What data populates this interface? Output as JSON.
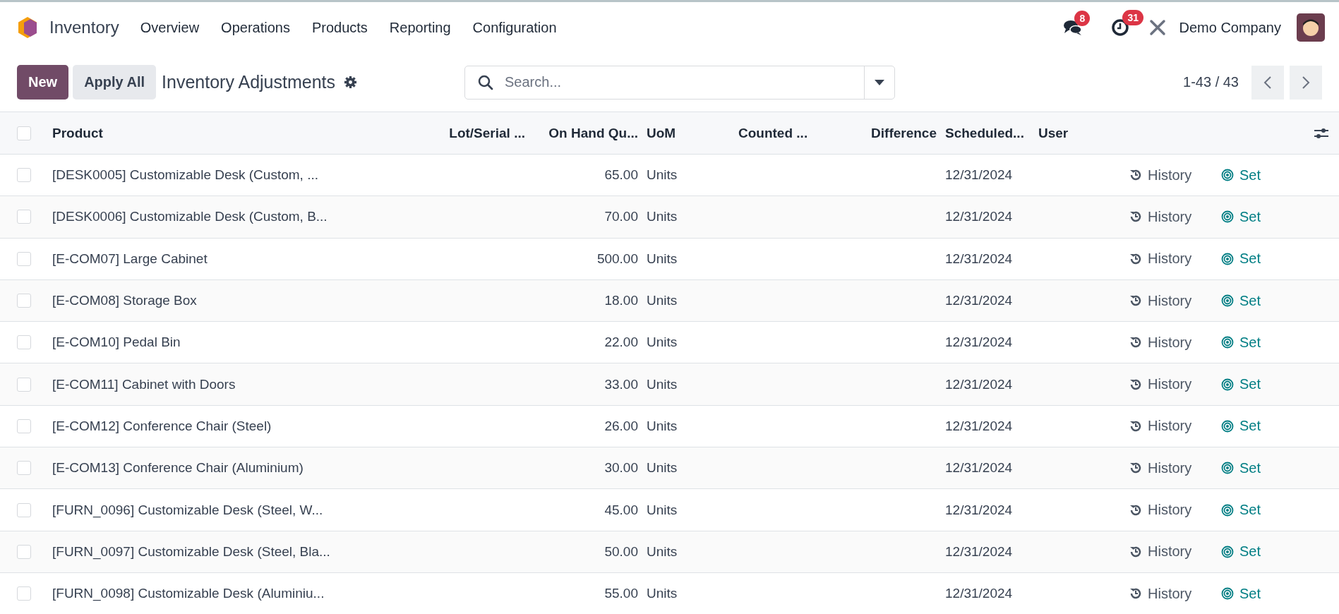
{
  "navbar": {
    "app_name": "Inventory",
    "menu": [
      "Overview",
      "Operations",
      "Products",
      "Reporting",
      "Configuration"
    ],
    "messages_badge": "8",
    "activities_badge": "31",
    "company": "Demo Company"
  },
  "control_panel": {
    "new_button": "New",
    "apply_all_button": "Apply All",
    "title": "Inventory Adjustments",
    "search": {
      "placeholder": "Search..."
    },
    "pager": "1-43 / 43"
  },
  "table": {
    "select_all_checked": false,
    "columns": [
      "Product",
      "Lot/Serial ...",
      "On Hand Qu...",
      "UoM",
      "Counted ...",
      "Difference",
      "Scheduled...",
      "User"
    ],
    "rows": [
      {
        "checked": false,
        "product": "[DESK0005] Customizable Desk (Custom, ...",
        "on_hand": "65.00",
        "uom": "Units",
        "scheduled": "12/31/2024",
        "history": "History",
        "set": "Set"
      },
      {
        "checked": false,
        "product": "[DESK0006] Customizable Desk (Custom, B...",
        "on_hand": "70.00",
        "uom": "Units",
        "scheduled": "12/31/2024",
        "history": "History",
        "set": "Set"
      },
      {
        "checked": false,
        "product": "[E-COM07] Large Cabinet",
        "on_hand": "500.00",
        "uom": "Units",
        "scheduled": "12/31/2024",
        "history": "History",
        "set": "Set"
      },
      {
        "checked": false,
        "product": "[E-COM08] Storage Box",
        "on_hand": "18.00",
        "uom": "Units",
        "scheduled": "12/31/2024",
        "history": "History",
        "set": "Set"
      },
      {
        "checked": false,
        "product": "[E-COM10] Pedal Bin",
        "on_hand": "22.00",
        "uom": "Units",
        "scheduled": "12/31/2024",
        "history": "History",
        "set": "Set"
      },
      {
        "checked": false,
        "product": "[E-COM11] Cabinet with Doors",
        "on_hand": "33.00",
        "uom": "Units",
        "scheduled": "12/31/2024",
        "history": "History",
        "set": "Set"
      },
      {
        "checked": false,
        "product": "[E-COM12] Conference Chair (Steel)",
        "on_hand": "26.00",
        "uom": "Units",
        "scheduled": "12/31/2024",
        "history": "History",
        "set": "Set"
      },
      {
        "checked": false,
        "product": "[E-COM13] Conference Chair (Aluminium)",
        "on_hand": "30.00",
        "uom": "Units",
        "scheduled": "12/31/2024",
        "history": "History",
        "set": "Set"
      },
      {
        "checked": false,
        "product": "[FURN_0096] Customizable Desk (Steel, W...",
        "on_hand": "45.00",
        "uom": "Units",
        "scheduled": "12/31/2024",
        "history": "History",
        "set": "Set"
      },
      {
        "checked": false,
        "product": "[FURN_0097] Customizable Desk (Steel, Bla...",
        "on_hand": "50.00",
        "uom": "Units",
        "scheduled": "12/31/2024",
        "history": "History",
        "set": "Set"
      },
      {
        "checked": false,
        "product": "[FURN_0098] Customizable Desk (Aluminiu...",
        "on_hand": "55.00",
        "uom": "Units",
        "scheduled": "12/31/2024",
        "history": "History",
        "set": "Set"
      }
    ]
  }
}
